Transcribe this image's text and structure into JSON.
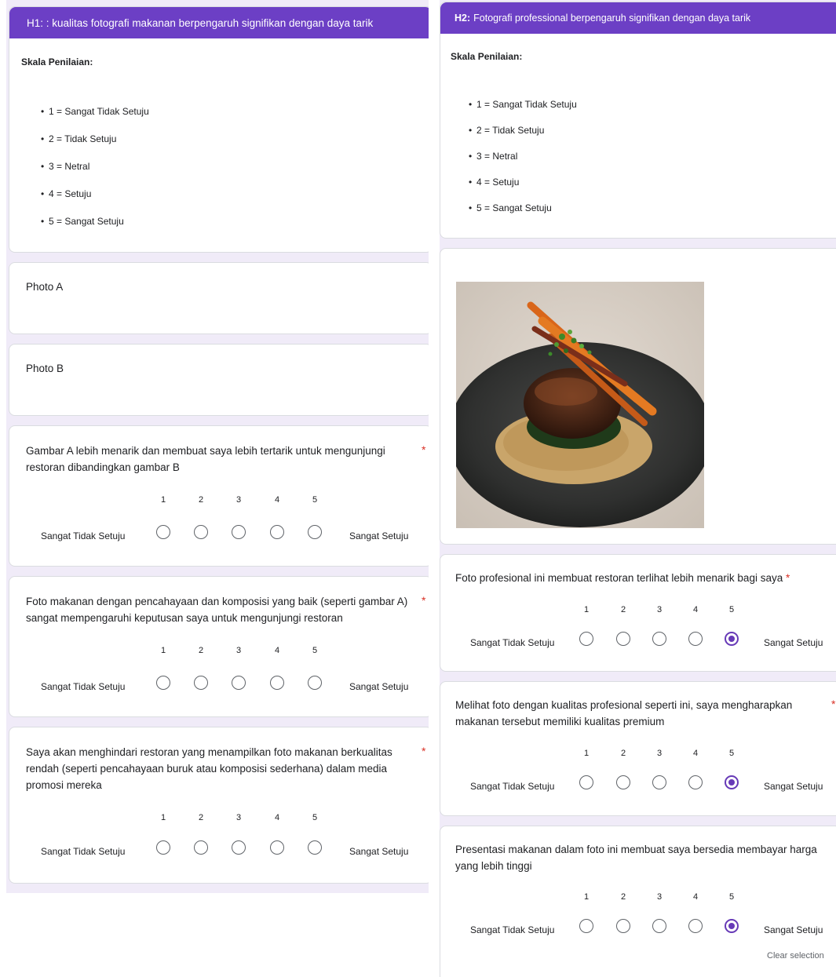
{
  "left": {
    "header_title": "H1: : kualitas fotografi makanan berpengaruh signifikan dengan daya tarik",
    "scale_title": "Skala Penilaian:",
    "scale_items": [
      "1 = Sangat Tidak Setuju",
      "2 = Tidak Setuju",
      "3 = Netral",
      "4 = Setuju",
      "5 = Sangat Setuju"
    ],
    "photo_a": "Photo A",
    "photo_b": "Photo B",
    "questions": [
      {
        "text": "Gambar A lebih menarik dan membuat saya lebih tertarik untuk mengunjungi restoran dibandingkan gambar B",
        "required": "*",
        "low": "Sangat Tidak Setuju",
        "high": "Sangat Setuju",
        "numbers": [
          "1",
          "2",
          "3",
          "4",
          "5"
        ],
        "selected": null
      },
      {
        "text": "Foto makanan dengan pencahayaan dan komposisi yang baik (seperti gambar A) sangat mempengaruhi keputusan saya untuk mengunjungi restoran",
        "required": "*",
        "low": "Sangat Tidak Setuju",
        "high": "Sangat Setuju",
        "numbers": [
          "1",
          "2",
          "3",
          "4",
          "5"
        ],
        "selected": null
      },
      {
        "text": "Saya akan menghindari restoran yang menampilkan foto makanan berkualitas rendah (seperti pencahayaan buruk atau komposisi sederhana) dalam media promosi mereka",
        "required": "*",
        "low": "Sangat Tidak Setuju",
        "high": "Sangat Setuju",
        "numbers": [
          "1",
          "2",
          "3",
          "4",
          "5"
        ],
        "selected": null
      }
    ]
  },
  "right": {
    "header_prefix": "H2:",
    "header_title": "Fotografi professional berpengaruh signifikan dengan daya tarik",
    "scale_title": "Skala Penilaian:",
    "scale_items": [
      "1 = Sangat Tidak Setuju",
      "2 = Tidak Setuju",
      "3 = Netral",
      "4 = Setuju",
      "5 = Sangat Setuju"
    ],
    "photo_icon": "food-photo-plated-dish",
    "questions": [
      {
        "text": "Foto profesional ini membuat restoran terlihat lebih menarik bagi saya",
        "required": "*",
        "low": "Sangat Tidak Setuju",
        "high": "Sangat Setuju",
        "numbers": [
          "1",
          "2",
          "3",
          "4",
          "5"
        ],
        "selected": 5
      },
      {
        "text": "Melihat foto dengan kualitas profesional seperti ini, saya mengharapkan makanan tersebut memiliki kualitas premium",
        "required": "*",
        "low": "Sangat Tidak Setuju",
        "high": "Sangat Setuju",
        "numbers": [
          "1",
          "2",
          "3",
          "4",
          "5"
        ],
        "selected": 5
      },
      {
        "text": "Presentasi makanan dalam foto ini membuat saya bersedia membayar harga yang lebih tinggi",
        "required": "",
        "low": "Sangat Tidak Setuju",
        "high": "Sangat Setuju",
        "numbers": [
          "1",
          "2",
          "3",
          "4",
          "5"
        ],
        "selected": 5
      }
    ],
    "clear_selection": "Clear selection"
  },
  "colors": {
    "accent": "#673ab7",
    "header": "#6c3fc5",
    "background": "#f0ebf8",
    "required": "#d93025"
  }
}
